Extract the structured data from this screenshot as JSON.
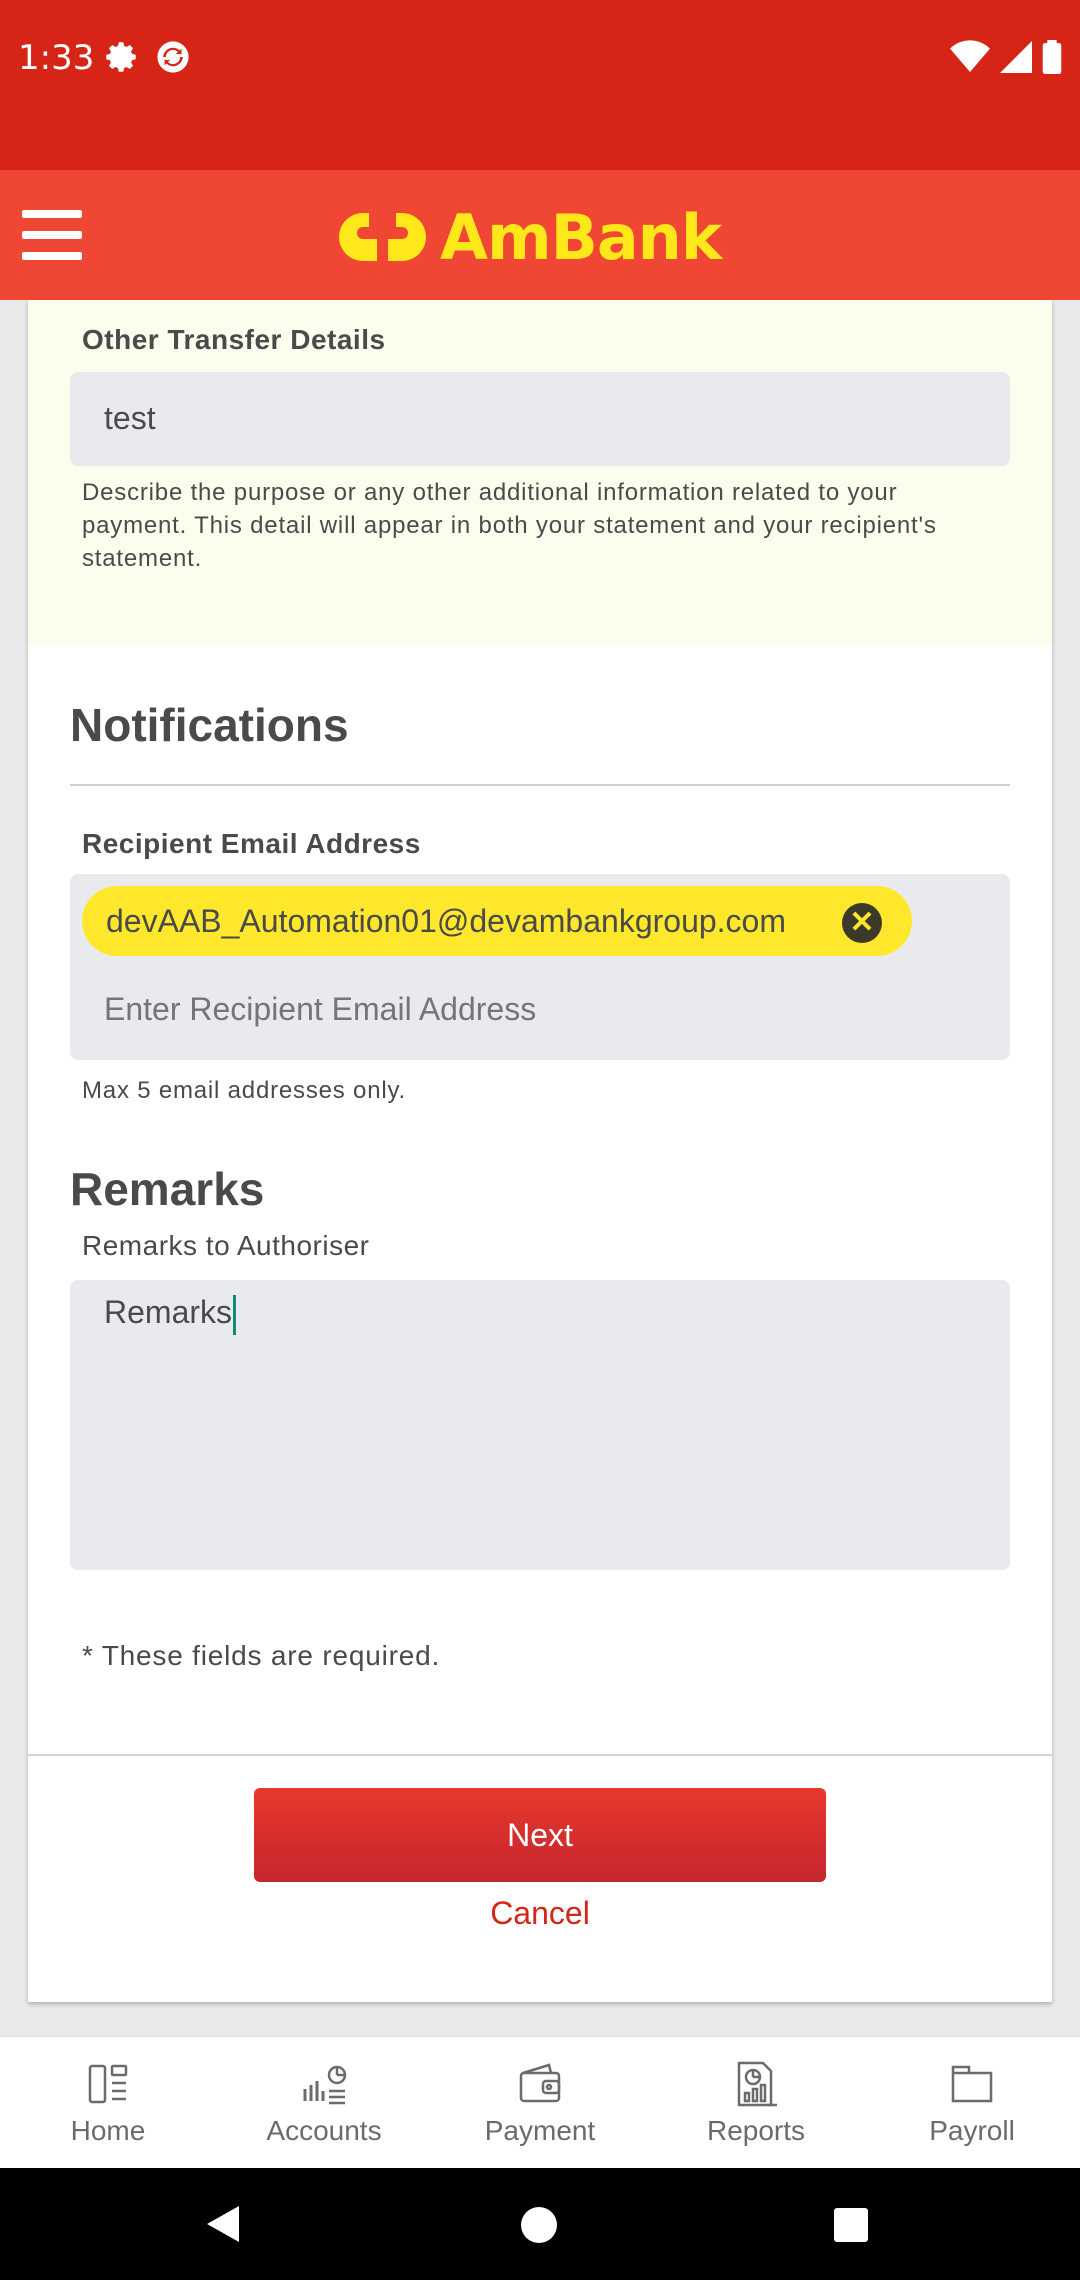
{
  "status_bar": {
    "time": "1:33",
    "icons": [
      "gear-icon",
      "sync-icon",
      "wifi-icon",
      "signal-icon",
      "battery-icon"
    ]
  },
  "header": {
    "logo_text": "AmBank",
    "menu_icon": "hamburger-icon",
    "colors": {
      "status_bar": "#d62416",
      "header": "#ef4734",
      "logo": "#ffe81a"
    }
  },
  "transfer": {
    "label": "Other Transfer Details",
    "value": "test",
    "help": "Describe the purpose or any other additional information related to your payment. This detail will appear in both your statement and your recipient's statement."
  },
  "notifications": {
    "heading": "Notifications",
    "email_label": "Recipient Email Address",
    "email_chip": "devAAB_Automation01@devambankgroup.com",
    "email_placeholder": "Enter Recipient Email Address",
    "email_help": "Max 5 email addresses only."
  },
  "remarks": {
    "heading": "Remarks",
    "label": "Remarks to Authoriser",
    "value": "Remarks"
  },
  "required_note": "* These fields are required.",
  "actions": {
    "next": "Next",
    "cancel": "Cancel"
  },
  "bottom_nav": [
    {
      "label": "Home",
      "icon": "home-icon"
    },
    {
      "label": "Accounts",
      "icon": "accounts-icon"
    },
    {
      "label": "Payment",
      "icon": "wallet-icon"
    },
    {
      "label": "Reports",
      "icon": "reports-icon"
    },
    {
      "label": "Payroll",
      "icon": "folder-icon"
    }
  ]
}
